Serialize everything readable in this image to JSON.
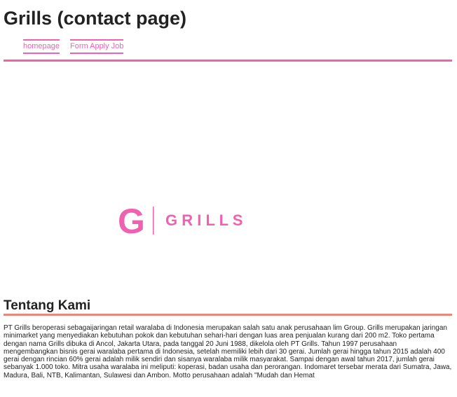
{
  "header": {
    "title": "Grills (contact page)",
    "nav": [
      {
        "label": "homepage"
      },
      {
        "label": "Form Apply Job"
      }
    ]
  },
  "logo": {
    "letter": "G",
    "wordmark": "G R I L L S",
    "color": "#f062b0"
  },
  "about": {
    "heading": "Tentang Kami",
    "body": "PT Grills beroperasi sebagaijaringan retail waralaba di Indonesia merupakan salah satu anak perusahaan lim Group. Grills merupakan jaringan minimarket yang menyediakan kebutuhan pokok dan kebutuhan sehari-hari dengan luas area penjualan kurang dari 200 m2. Toko pertama dengan nama Grills dibuka di Ancol, Jakarta Utara, pada tanggal 20 Juni 1988, dikelola oleh PT Grills. Tahun 1997 perusahaan mengembangkan bisnis gerai waralaba pertama di Indonesia, setelah memiliki lebih dari 30 gerai. Jumlah gerai hingga tahun 2015 adalah 400 gerai dengan rincian 60% gerai adalah milik sendiri dan sisanya waralaba milik masyarakat. Sampai dengan awal tahun 2017, jumlah gerai sebanyak 1.000 toko. Mitra usaha waralaba ini meliputi: koperasi, badan usaha dan perorangan. Indomaret tersebar merata dari Sumatra, Jawa, Madura, Bali, NTB, Kalimantan, Sulawesi dan Ambon. Motto perusahaan adalah \"Mudah dan Hemat"
  },
  "colors": {
    "accent": "#f062b0",
    "section_rule": "#e88878"
  }
}
